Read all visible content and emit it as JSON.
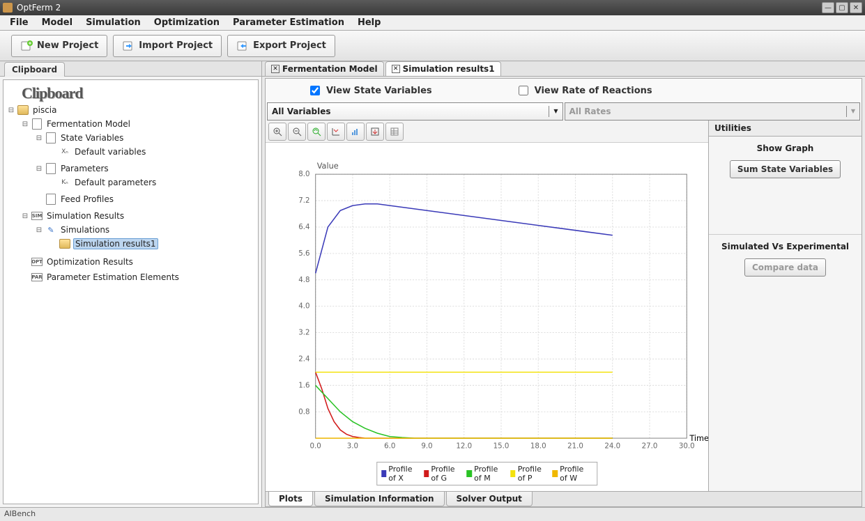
{
  "window": {
    "title": "OptFerm 2"
  },
  "menu": {
    "items": [
      "File",
      "Model",
      "Simulation",
      "Optimization",
      "Parameter Estimation",
      "Help"
    ]
  },
  "toolbar": {
    "new_label": "New Project",
    "import_label": "Import Project",
    "export_label": "Export Project"
  },
  "left": {
    "tab_label": "Clipboard",
    "logo": "Clipboard",
    "root": "piscia",
    "fmodel": "Fermentation Model",
    "state_vars": "State Variables",
    "def_vars": "Default variables",
    "params": "Parameters",
    "def_params": "Default parameters",
    "feed": "Feed Profiles",
    "simres": "Simulation Results",
    "sims": "Simulations",
    "simres1": "Simulation results1",
    "optres": "Optimization Results",
    "parest": "Parameter Estimation Elements"
  },
  "doctabs": {
    "tab1": "Fermentation Model",
    "tab2": "Simulation results1"
  },
  "viewopts": {
    "state_label": "View State Variables",
    "rate_label": "View Rate of Reactions"
  },
  "combos": {
    "vars": "All Variables",
    "rates": "All Rates"
  },
  "util": {
    "title": "Utilities",
    "show_graph": "Show Graph",
    "sum_btn": "Sum State Variables",
    "sim_vs_exp": "Simulated Vs Experimental",
    "compare_btn": "Compare data"
  },
  "bottomtabs": {
    "plots": "Plots",
    "siminfo": "Simulation Information",
    "solver": "Solver Output"
  },
  "status": {
    "brand": "AIBench"
  },
  "chart_data": {
    "type": "line",
    "title": "",
    "xlabel": "Time",
    "ylabel": "Value",
    "xlim": [
      0,
      30
    ],
    "ylim": [
      0,
      8
    ],
    "xticks": [
      0.0,
      3.0,
      6.0,
      9.0,
      12.0,
      15.0,
      18.0,
      21.0,
      24.0,
      27.0,
      30.0
    ],
    "yticks": [
      0.8,
      1.6,
      2.4,
      3.2,
      4.0,
      4.8,
      5.6,
      6.4,
      7.2,
      8.0
    ],
    "series": [
      {
        "name": "Profile of X",
        "color": "#3a3ab8",
        "x": [
          0,
          1,
          2,
          3,
          4,
          5,
          6,
          8,
          10,
          12,
          14,
          16,
          18,
          20,
          22,
          24
        ],
        "y": [
          5.0,
          6.4,
          6.9,
          7.05,
          7.1,
          7.1,
          7.05,
          6.95,
          6.85,
          6.75,
          6.65,
          6.55,
          6.45,
          6.35,
          6.25,
          6.15
        ]
      },
      {
        "name": "Profile of G",
        "color": "#d11a1a",
        "x": [
          0,
          0.5,
          1.0,
          1.5,
          2.0,
          2.5,
          3.0,
          3.5,
          4,
          5,
          6,
          24
        ],
        "y": [
          2.0,
          1.5,
          0.9,
          0.5,
          0.25,
          0.12,
          0.05,
          0.02,
          0,
          0,
          0,
          0
        ]
      },
      {
        "name": "Profile of M",
        "color": "#29c224",
        "x": [
          0,
          1,
          2,
          3,
          4,
          5,
          6,
          7,
          8,
          24
        ],
        "y": [
          1.6,
          1.2,
          0.8,
          0.5,
          0.3,
          0.15,
          0.05,
          0.02,
          0,
          0
        ]
      },
      {
        "name": "Profile of P",
        "color": "#f4e20c",
        "x": [
          0,
          2,
          4,
          6,
          8,
          10,
          12,
          14,
          16,
          18,
          20,
          22,
          24
        ],
        "y": [
          2.0,
          2.0,
          2.0,
          2.0,
          2.0,
          2.0,
          2.0,
          2.0,
          2.0,
          2.0,
          2.0,
          2.0,
          2.0
        ]
      },
      {
        "name": "Profile of W",
        "color": "#f0b800",
        "x": [
          0,
          24
        ],
        "y": [
          0,
          0
        ]
      }
    ],
    "legend": [
      "Profile of X",
      "Profile of G",
      "Profile of M",
      "Profile of P",
      "Profile of W"
    ]
  }
}
